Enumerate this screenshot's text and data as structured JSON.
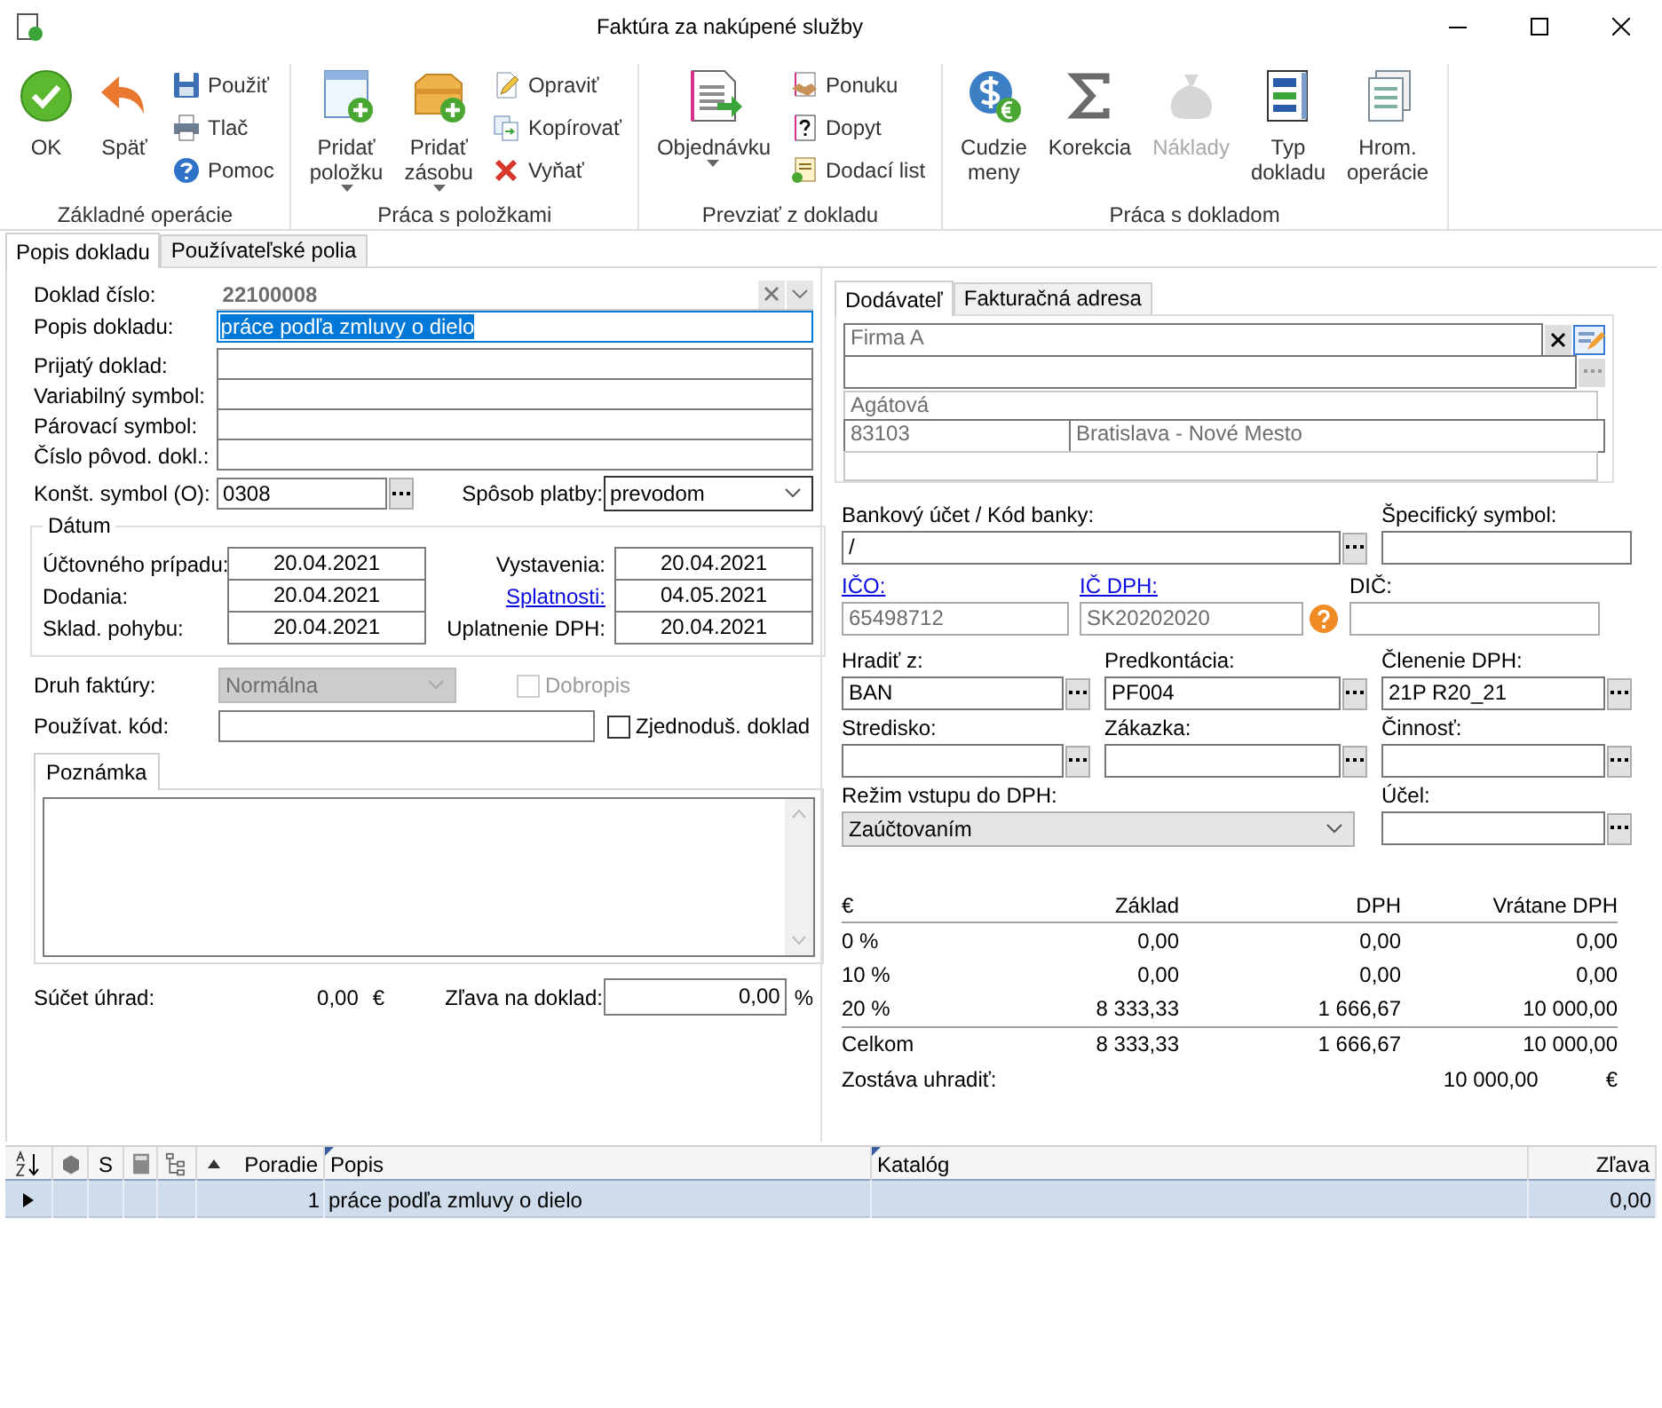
{
  "window": {
    "title": "Faktúra za nakúpené služby"
  },
  "ribbon": [
    {
      "label": "Základné operácie",
      "buttons": [
        {
          "kind": "large",
          "lines": [
            "OK"
          ],
          "menu": false,
          "disabled": false
        },
        {
          "kind": "large",
          "lines": [
            "Späť"
          ],
          "menu": false,
          "disabled": false
        },
        {
          "kind": "small",
          "lines": [
            "Použiť"
          ]
        },
        {
          "kind": "small",
          "lines": [
            "Tlač"
          ]
        },
        {
          "kind": "small",
          "lines": [
            "Pomoc"
          ]
        }
      ]
    },
    {
      "label": "Práca s položkami",
      "buttons": [
        {
          "kind": "large",
          "lines": [
            "Pridať",
            "položku"
          ],
          "menu": true,
          "disabled": false
        },
        {
          "kind": "large",
          "lines": [
            "Pridať",
            "zásobu"
          ],
          "menu": true,
          "disabled": false
        },
        {
          "kind": "small",
          "lines": [
            "Opraviť"
          ]
        },
        {
          "kind": "small",
          "lines": [
            "Kopírovať"
          ]
        },
        {
          "kind": "small",
          "lines": [
            "Vyňať"
          ]
        }
      ]
    },
    {
      "label": "Prevziať z dokladu",
      "buttons": [
        {
          "kind": "large",
          "lines": [
            "Objednávku"
          ],
          "menu": true,
          "disabled": false
        },
        {
          "kind": "small",
          "lines": [
            "Ponuku"
          ]
        },
        {
          "kind": "small",
          "lines": [
            "Dopyt"
          ]
        },
        {
          "kind": "small",
          "lines": [
            "Dodací list"
          ]
        }
      ]
    },
    {
      "label": "Práca s dokladom",
      "buttons": [
        {
          "kind": "large",
          "lines": [
            "Cudzie",
            "meny"
          ],
          "menu": false,
          "disabled": false
        },
        {
          "kind": "large",
          "lines": [
            "Korekcia"
          ],
          "menu": false,
          "disabled": false
        },
        {
          "kind": "large",
          "lines": [
            "Náklady"
          ],
          "menu": false,
          "disabled": true
        },
        {
          "kind": "large",
          "lines": [
            "Typ",
            "dokladu"
          ],
          "menu": false,
          "disabled": false
        },
        {
          "kind": "large",
          "lines": [
            "Hrom.",
            "operácie"
          ],
          "menu": false,
          "disabled": false
        }
      ]
    }
  ],
  "document_tabs": [
    {
      "label": "Popis dokladu",
      "selected": true
    },
    {
      "label": "Používateľské polia",
      "selected": false
    }
  ],
  "header": {
    "number": {
      "label": "Doklad číslo:",
      "value": "22100008"
    },
    "description": {
      "label": "Popis dokladu:",
      "value": "práce podľa zmluvy o dielo"
    },
    "fields": [
      {
        "label": "Prijatý doklad:"
      },
      {
        "label": "Variabilný symbol:"
      },
      {
        "label": "Párovací symbol:"
      },
      {
        "label": "Číslo pôvod. dokl.:"
      }
    ],
    "constant_symbol": {
      "label": "Konšt. symbol (O):",
      "value": "0308"
    },
    "payment": {
      "label": "Spôsob platby:",
      "value": "prevodom"
    }
  },
  "dates": {
    "title": "Dátum",
    "left": [
      {
        "label": "Účtovného prípadu:",
        "value": "20.04.2021",
        "link": false
      },
      {
        "label": "Dodania:",
        "value": "20.04.2021",
        "link": false
      },
      {
        "label": "Sklad. pohybu:",
        "value": "20.04.2021",
        "link": false
      }
    ],
    "right": [
      {
        "label": "Vystavenia:",
        "value": "20.04.2021",
        "link": false
      },
      {
        "label": "Splatnosti:",
        "value": "04.05.2021",
        "link": true
      },
      {
        "label": "Uplatnenie DPH:",
        "value": "20.04.2021",
        "link": false
      }
    ]
  },
  "invoice_type": {
    "label": "Druh faktúry:",
    "value": "Normálna",
    "disabled": true
  },
  "credit_note": {
    "label": "Dobropis",
    "checked": false,
    "disabled": true
  },
  "user_code": {
    "label": "Používat. kód:"
  },
  "simplified": {
    "label": "Zjednoduš. doklad",
    "checked": false,
    "disabled": false
  },
  "note": {
    "tab": "Poznámka"
  },
  "payments_sum": {
    "label": "Súčet úhrad:",
    "value": "0,00",
    "currency": "€"
  },
  "discount": {
    "label": "Zľava na doklad:",
    "value": "0,00",
    "unit": "%"
  },
  "partner_tabs": [
    {
      "label": "Dodávateľ",
      "selected": true
    },
    {
      "label": "Fakturačná adresa",
      "selected": false
    }
  ],
  "address": {
    "name": "Firma A",
    "street": "Agátová",
    "zip": "83103",
    "city": "Bratislava - Nové Mesto"
  },
  "bank": {
    "label": "Bankový účet / Kód banky:",
    "value": "/"
  },
  "specific_symbol": {
    "label": "Špecifický symbol:"
  },
  "ico": {
    "label": "IČO:",
    "value": "65498712"
  },
  "ic_dph": {
    "label": "IČ DPH:",
    "value": "SK20202020"
  },
  "dic": {
    "label": "DIČ:"
  },
  "codes": [
    {
      "label": "Hradiť z:",
      "value": "BAN"
    },
    {
      "label": "Predkontácia:",
      "value": "PF004"
    },
    {
      "label": "Členenie DPH:",
      "value": "21P R20_21"
    },
    {
      "label": "Stredisko:"
    },
    {
      "label": "Zákazka:"
    },
    {
      "label": "Činnosť:"
    }
  ],
  "vat_regime": {
    "label": "Režim vstupu do DPH:",
    "value": "Zaúčtovaním"
  },
  "purpose": {
    "label": "Účel:"
  },
  "vat_table": {
    "columns": [
      "€",
      "Základ",
      "DPH",
      "Vrátane DPH"
    ],
    "rows": [
      [
        "0 %",
        "0,00",
        "0,00",
        "0,00"
      ],
      [
        "10 %",
        "0,00",
        "0,00",
        "0,00"
      ],
      [
        "20 %",
        "8 333,33",
        "1 666,67",
        "10 000,00"
      ]
    ],
    "total": [
      "Celkom",
      "8 333,33",
      "1 666,67",
      "10 000,00"
    ]
  },
  "remaining": {
    "label": "Zostáva uhradiť:",
    "value": "10 000,00",
    "currency": "€"
  },
  "items_grid": {
    "flag_column": "S",
    "columns": [
      "Poradie",
      "Popis",
      "Katalóg",
      "Zľava"
    ],
    "rows": [
      {
        "order": "1",
        "description": "práce podľa zmluvy o dielo",
        "discount": "0,00",
        "selected": true
      }
    ]
  }
}
